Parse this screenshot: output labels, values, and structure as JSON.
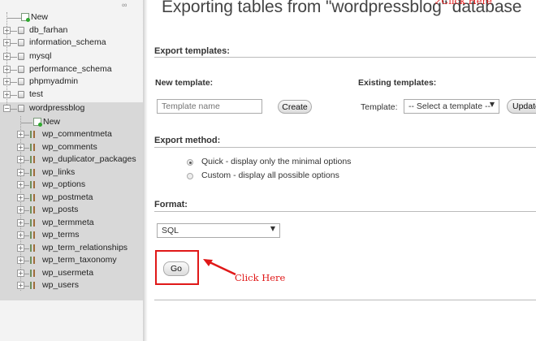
{
  "nav": {
    "top_new_label": "New",
    "databases": [
      {
        "label": "db_farhan"
      },
      {
        "label": "information_schema"
      },
      {
        "label": "mysql"
      },
      {
        "label": "performance_schema"
      },
      {
        "label": "phpmyadmin"
      },
      {
        "label": "test"
      },
      {
        "label": "wordpressblog"
      }
    ],
    "db_new_label": "New",
    "tables": [
      "wp_commentmeta",
      "wp_comments",
      "wp_duplicator_packages",
      "wp_links",
      "wp_options",
      "wp_postmeta",
      "wp_posts",
      "wp_termmeta",
      "wp_terms",
      "wp_term_relationships",
      "wp_term_taxonomy",
      "wp_usermeta",
      "wp_users"
    ]
  },
  "main": {
    "title": "Exporting tables from \"wordpressblog\" database",
    "export_templates": {
      "heading": "Export templates:",
      "new_template_label": "New template:",
      "template_name_placeholder": "Template name",
      "create_label": "Create",
      "existing_templates_label": "Existing templates:",
      "template_label": "Template:",
      "select_value": "-- Select a template --",
      "update_label": "Update"
    },
    "export_method": {
      "heading": "Export method:",
      "options": [
        {
          "label": "Quick - display only the minimal options",
          "selected": true
        },
        {
          "label": "Custom - display all possible options",
          "selected": false
        }
      ]
    },
    "format": {
      "heading": "Format:",
      "value": "SQL"
    },
    "go_label": "Go"
  },
  "annotations": {
    "top_click_here": "Click Here",
    "go_click_here": "Click Here",
    "color": "#e01818"
  }
}
